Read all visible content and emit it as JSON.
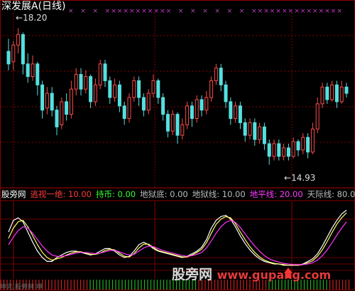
{
  "chart_title": "深发展A(日线)",
  "price_high_label": "18.20",
  "price_low_label": "14.93",
  "indicator_name": "股旁网",
  "indicator_items": [
    {
      "label": "逃视一绝:",
      "value": "10.00",
      "color": "#ff3b3b"
    },
    {
      "label": "持币:",
      "value": "0.00",
      "color": "#33ff33"
    },
    {
      "label": "地狱底:",
      "value": "0.00",
      "color": "#bbbbbb"
    },
    {
      "label": "地狱线:",
      "value": "10.00",
      "color": "#bbbbbb"
    },
    {
      "label": "地平线:",
      "value": "20.00",
      "color": "#ff3bff"
    },
    {
      "label": "天际线:",
      "value": "80.0",
      "color": "#bbbbbb"
    }
  ],
  "watermark": "股旁网 www.gupang.com",
  "footer_text": "坤完 股旁网 坤",
  "colors": {
    "up": "#ff4a4a",
    "down": "#54e0e0",
    "grid": "#8b0000",
    "buy_marker": "#ff3333",
    "sell_marker": "#cc33cc"
  },
  "chart_data": [
    {
      "type": "candlestick",
      "title": "深发展A(日线)",
      "annotations": [
        "18.20",
        "14.93"
      ],
      "ylim": [
        14.5,
        18.5
      ],
      "candles": [
        [
          17.65,
          17.35,
          17.95,
          17.2
        ],
        [
          17.4,
          17.8,
          17.9,
          17.2
        ],
        [
          17.8,
          18.05,
          18.2,
          17.6
        ],
        [
          18.05,
          17.35,
          18.1,
          17.1
        ],
        [
          17.35,
          17.05,
          17.6,
          16.9
        ],
        [
          17.05,
          17.35,
          17.55,
          16.95
        ],
        [
          17.35,
          16.85,
          17.4,
          16.6
        ],
        [
          16.85,
          16.25,
          16.95,
          16.05
        ],
        [
          16.3,
          16.65,
          16.8,
          16.15
        ],
        [
          16.65,
          16.25,
          16.8,
          16.1
        ],
        [
          16.25,
          15.85,
          16.35,
          15.65
        ],
        [
          15.9,
          16.45,
          16.55,
          15.8
        ],
        [
          16.45,
          16.15,
          16.65,
          16.0
        ],
        [
          16.15,
          16.75,
          16.95,
          16.05
        ],
        [
          16.75,
          17.1,
          17.25,
          16.6
        ],
        [
          17.1,
          16.75,
          17.25,
          16.6
        ],
        [
          16.75,
          17.05,
          17.2,
          16.65
        ],
        [
          17.05,
          16.45,
          17.1,
          16.3
        ],
        [
          16.45,
          16.85,
          17.0,
          16.35
        ],
        [
          16.85,
          17.35,
          17.45,
          16.75
        ],
        [
          17.35,
          16.95,
          17.45,
          16.8
        ],
        [
          16.95,
          16.55,
          17.05,
          16.4
        ],
        [
          16.55,
          16.85,
          17.0,
          16.45
        ],
        [
          16.85,
          16.35,
          16.95,
          16.2
        ],
        [
          16.35,
          16.05,
          16.45,
          15.9
        ],
        [
          16.05,
          16.55,
          16.65,
          15.95
        ],
        [
          16.55,
          16.95,
          17.05,
          16.45
        ],
        [
          16.95,
          16.55,
          17.05,
          16.35
        ],
        [
          16.55,
          16.25,
          16.65,
          16.1
        ],
        [
          16.25,
          16.65,
          16.75,
          16.15
        ],
        [
          16.65,
          16.95,
          17.1,
          16.55
        ],
        [
          16.95,
          16.55,
          17.0,
          16.4
        ],
        [
          16.55,
          16.15,
          16.65,
          16.0
        ],
        [
          16.15,
          15.75,
          16.25,
          15.6
        ],
        [
          15.75,
          16.15,
          16.25,
          15.65
        ],
        [
          16.15,
          15.65,
          16.2,
          15.45
        ],
        [
          15.65,
          15.9,
          16.05,
          15.55
        ],
        [
          15.9,
          16.35,
          16.45,
          15.8
        ],
        [
          16.35,
          16.05,
          16.45,
          15.85
        ],
        [
          16.05,
          16.5,
          16.6,
          15.95
        ],
        [
          16.5,
          16.25,
          16.6,
          16.1
        ],
        [
          16.25,
          16.55,
          16.7,
          16.15
        ],
        [
          16.55,
          16.95,
          17.05,
          16.45
        ],
        [
          16.95,
          17.25,
          17.35,
          16.85
        ],
        [
          17.25,
          16.85,
          17.35,
          16.7
        ],
        [
          16.85,
          16.45,
          16.95,
          16.3
        ],
        [
          16.45,
          16.05,
          16.55,
          15.9
        ],
        [
          16.05,
          16.35,
          16.45,
          15.95
        ],
        [
          16.35,
          15.95,
          16.45,
          15.8
        ],
        [
          15.95,
          15.65,
          16.05,
          15.5
        ],
        [
          15.65,
          15.95,
          16.05,
          15.55
        ],
        [
          15.95,
          15.55,
          16.05,
          15.4
        ],
        [
          15.55,
          15.85,
          15.95,
          15.45
        ],
        [
          15.85,
          15.45,
          15.95,
          15.3
        ],
        [
          15.45,
          15.15,
          15.55,
          14.95
        ],
        [
          15.15,
          15.45,
          15.55,
          15.05
        ],
        [
          15.45,
          15.15,
          15.55,
          15.05
        ],
        [
          15.15,
          15.35,
          15.45,
          15.05
        ],
        [
          15.35,
          15.15,
          15.45,
          15.05
        ],
        [
          15.15,
          15.5,
          15.6,
          15.1
        ],
        [
          15.5,
          15.3,
          15.55,
          15.15
        ],
        [
          15.3,
          15.6,
          15.7,
          15.2
        ],
        [
          15.6,
          15.25,
          15.7,
          15.1
        ],
        [
          15.25,
          15.8,
          15.95,
          15.2
        ],
        [
          15.8,
          16.4,
          16.55,
          15.7
        ],
        [
          16.4,
          16.8,
          16.9,
          16.3
        ],
        [
          16.8,
          16.5,
          16.9,
          16.4
        ],
        [
          16.5,
          16.85,
          16.95,
          16.45
        ],
        [
          16.85,
          16.45,
          16.95,
          16.3
        ],
        [
          16.45,
          16.8,
          16.95,
          16.4
        ],
        [
          16.8,
          16.65,
          16.9,
          16.55
        ]
      ]
    },
    {
      "type": "line",
      "title": "股旁网",
      "ylim": [
        0,
        100
      ],
      "reference_lines": [
        0,
        10,
        20,
        80
      ],
      "series": [
        {
          "name": "",
          "color": "#ffffff",
          "values": [
            60,
            78,
            82,
            76,
            60,
            44,
            30,
            20,
            14,
            14,
            20,
            24,
            28,
            30,
            30,
            28,
            26,
            24,
            26,
            30,
            34,
            34,
            30,
            24,
            20,
            22,
            30,
            40,
            44,
            40,
            34,
            30,
            28,
            26,
            24,
            22,
            20,
            22,
            26,
            30,
            36,
            48,
            66,
            78,
            84,
            86,
            80,
            68,
            54,
            42,
            32,
            24,
            18,
            14,
            12,
            10,
            10,
            8,
            8,
            8,
            8,
            10,
            14,
            18,
            26,
            38,
            52,
            66,
            78,
            88,
            94
          ]
        },
        {
          "name": "",
          "color": "#ffff66",
          "values": [
            50,
            66,
            76,
            78,
            68,
            54,
            40,
            28,
            20,
            16,
            18,
            20,
            24,
            27,
            29,
            29,
            27,
            25,
            25,
            27,
            31,
            33,
            32,
            27,
            22,
            21,
            26,
            35,
            41,
            41,
            36,
            31,
            29,
            27,
            25,
            23,
            21,
            21,
            24,
            28,
            33,
            43,
            58,
            72,
            80,
            84,
            82,
            73,
            60,
            48,
            37,
            28,
            21,
            16,
            13,
            11,
            10,
            9,
            8,
            8,
            8,
            9,
            12,
            15,
            22,
            32,
            45,
            59,
            72,
            82,
            90
          ]
        },
        {
          "name": "",
          "color": "#ff33ff",
          "values": [
            40,
            52,
            62,
            68,
            66,
            58,
            48,
            38,
            30,
            24,
            22,
            22,
            23,
            25,
            27,
            28,
            28,
            27,
            26,
            27,
            29,
            31,
            31,
            29,
            26,
            24,
            25,
            30,
            35,
            38,
            37,
            34,
            31,
            29,
            27,
            25,
            23,
            22,
            23,
            25,
            28,
            35,
            46,
            58,
            68,
            75,
            78,
            75,
            67,
            57,
            47,
            38,
            30,
            23,
            18,
            15,
            13,
            11,
            10,
            9,
            9,
            9,
            10,
            12,
            16,
            23,
            32,
            43,
            55,
            66,
            76
          ]
        }
      ]
    }
  ]
}
